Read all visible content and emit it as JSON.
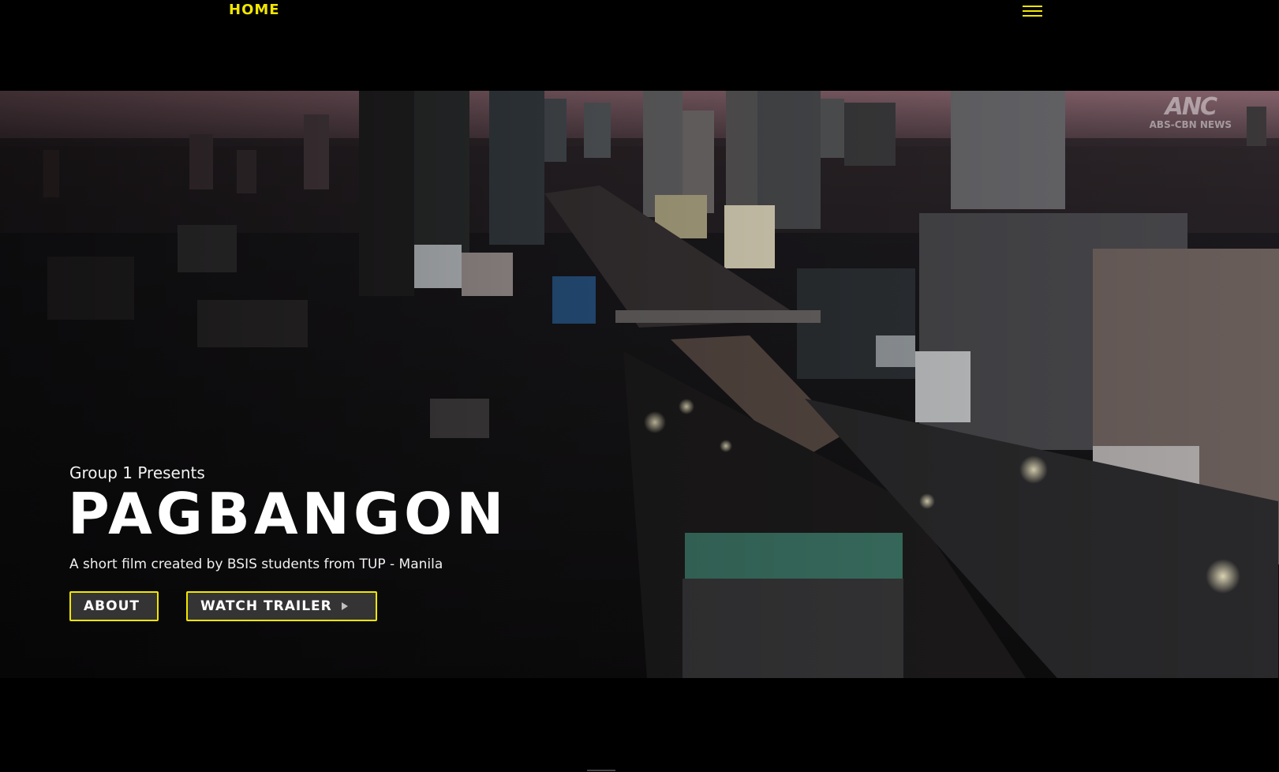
{
  "nav": {
    "home_label": "HOME",
    "menu_icon": "hamburger-menu-icon"
  },
  "hero": {
    "watermark": "ANC",
    "watermark_sub": "ABS-CBN NEWS",
    "presenter": "Group 1 Presents",
    "title": "PAGBANGON",
    "tagline": "A short film created by BSIS students from TUP - Manila",
    "about_label": "ABOUT",
    "trailer_label": "WATCH TRAILER",
    "trailer_icon": "play-icon"
  },
  "colors": {
    "accent": "#f2e600",
    "background": "#000000",
    "button_bg": "#3c3c3c",
    "text": "#ffffff"
  }
}
